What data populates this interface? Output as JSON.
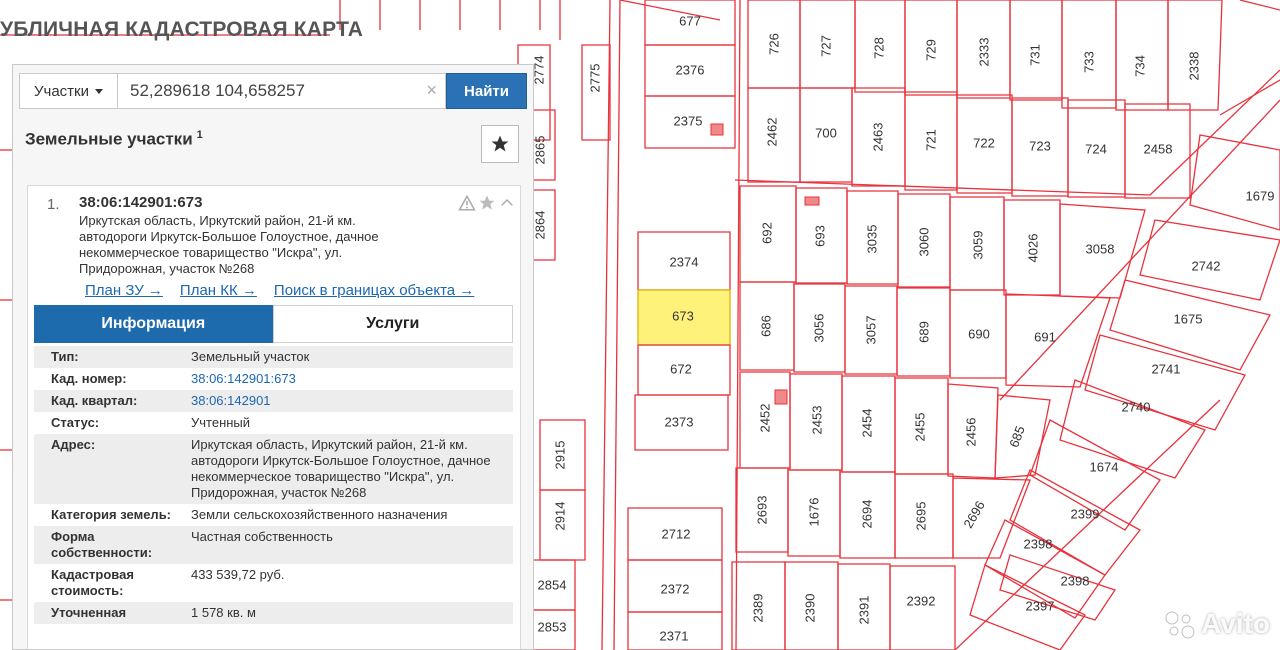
{
  "app": {
    "title": "УБЛИЧНАЯ КАДАСТРОВАЯ КАРТА"
  },
  "search": {
    "type": "Участки",
    "value": "52,289618 104,658257",
    "clear": "×",
    "button": "Найти"
  },
  "panel": {
    "title": "Земельные участки",
    "count": "1"
  },
  "result": {
    "number": "1.",
    "cad_number": "38:06:142901:673",
    "address_lines": [
      "Иркутская область, Иркутский район, 21-й км.",
      "автодороги Иркутск-Большое Голоустное, дачное",
      "некоммерческое товарищество \"Искра\", ул.",
      "Придорожная, участок №268"
    ],
    "links": [
      "План ЗУ →",
      "План КК →",
      "Поиск в границах объекта →"
    ],
    "tabs": [
      "Информация",
      "Услуги"
    ]
  },
  "info_rows": [
    {
      "label": "Тип:",
      "value": "Земельный участок"
    },
    {
      "label": "Кад. номер:",
      "value": "38:06:142901:673",
      "link": true
    },
    {
      "label": "Кад. квартал:",
      "value": "38:06:142901",
      "link": true
    },
    {
      "label": "Статус:",
      "value": "Учтенный"
    },
    {
      "label": "Адрес:",
      "value": "Иркутская область, Иркутский район, 21-й км. автодороги Иркутск-Большое Голоустное, дачное некоммерческое товарищество \"Искра\", ул. Придорожная, участок №268"
    },
    {
      "label": "Категория земель:",
      "value": "Земли сельскохозяйственного назначения"
    },
    {
      "label": "Форма собственности:",
      "value": "Частная собственность"
    },
    {
      "label": "Кадастровая стоимость:",
      "value": "433 539,72 руб."
    },
    {
      "label": "Уточненная",
      "value": "1 578 кв. м"
    }
  ],
  "watermark": "Avito",
  "map": {
    "line_color": "#e8323c",
    "highlight_color": "#fff27a",
    "parcels": [
      {
        "id": "677"
      },
      {
        "id": "2376"
      },
      {
        "id": "2375"
      },
      {
        "id": "2374"
      },
      {
        "id": "673",
        "selected": true
      },
      {
        "id": "672"
      },
      {
        "id": "2373"
      },
      {
        "id": "2712"
      },
      {
        "id": "2372"
      },
      {
        "id": "2371"
      },
      {
        "id": "726"
      },
      {
        "id": "727"
      },
      {
        "id": "728"
      },
      {
        "id": "729"
      },
      {
        "id": "2333"
      },
      {
        "id": "731"
      },
      {
        "id": "2462"
      },
      {
        "id": "700"
      },
      {
        "id": "2463"
      },
      {
        "id": "721"
      },
      {
        "id": "722"
      },
      {
        "id": "723"
      },
      {
        "id": "724"
      },
      {
        "id": "2458"
      },
      {
        "id": "692"
      },
      {
        "id": "693"
      },
      {
        "id": "3035"
      },
      {
        "id": "3060"
      },
      {
        "id": "3059"
      },
      {
        "id": "4026"
      },
      {
        "id": "3058"
      },
      {
        "id": "686"
      },
      {
        "id": "3056"
      },
      {
        "id": "3057"
      },
      {
        "id": "689"
      },
      {
        "id": "690"
      },
      {
        "id": "691"
      },
      {
        "id": "2452"
      },
      {
        "id": "2453"
      },
      {
        "id": "2454"
      },
      {
        "id": "2455"
      },
      {
        "id": "2456"
      },
      {
        "id": "685"
      },
      {
        "id": "2693"
      },
      {
        "id": "1676"
      },
      {
        "id": "2694"
      },
      {
        "id": "2695"
      },
      {
        "id": "2696"
      },
      {
        "id": "2389"
      },
      {
        "id": "2390"
      },
      {
        "id": "2391"
      },
      {
        "id": "2392"
      },
      {
        "id": "733"
      },
      {
        "id": "734"
      },
      {
        "id": "2338"
      },
      {
        "id": "1679"
      },
      {
        "id": "2742"
      },
      {
        "id": "1675"
      },
      {
        "id": "2741"
      },
      {
        "id": "2740"
      },
      {
        "id": "1674"
      },
      {
        "id": "2399"
      },
      {
        "id": "2398"
      },
      {
        "id": "2398"
      },
      {
        "id": "2397"
      },
      {
        "id": "2775"
      },
      {
        "id": "2774"
      },
      {
        "id": "2865"
      },
      {
        "id": "2864"
      },
      {
        "id": "2915"
      },
      {
        "id": "2914"
      },
      {
        "id": "2854"
      },
      {
        "id": "2853"
      }
    ]
  }
}
